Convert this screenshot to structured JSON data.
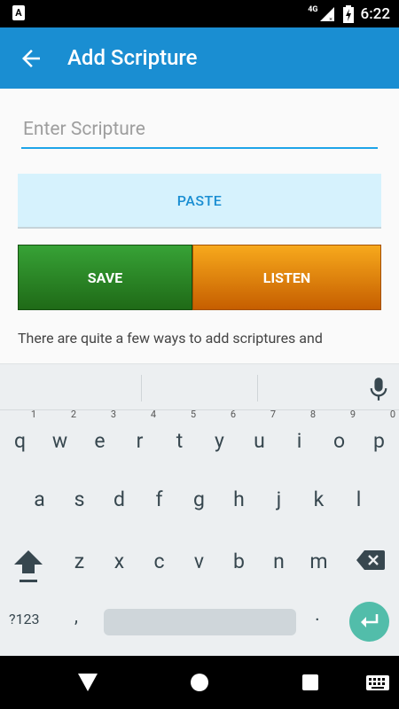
{
  "status_bar": {
    "app_icon_letter": "A",
    "network": "4G",
    "time": "6:22"
  },
  "app_bar": {
    "title": "Add Scripture",
    "back_icon": "arrow-back-icon"
  },
  "form": {
    "scripture_input": {
      "value": "",
      "placeholder": "Enter Scripture"
    },
    "paste_label": "PASTE",
    "save_label": "SAVE",
    "listen_label": "LISTEN",
    "help_text": "There are quite a few ways to add scriptures and"
  },
  "keyboard": {
    "row1": [
      "q",
      "w",
      "e",
      "r",
      "t",
      "y",
      "u",
      "i",
      "o",
      "p"
    ],
    "row1_hints": [
      "1",
      "2",
      "3",
      "4",
      "5",
      "6",
      "7",
      "8",
      "9",
      "0"
    ],
    "row2": [
      "a",
      "s",
      "d",
      "f",
      "g",
      "h",
      "j",
      "k",
      "l"
    ],
    "row3": [
      "z",
      "x",
      "c",
      "v",
      "b",
      "n",
      "m"
    ],
    "symbols_label": "?123",
    "comma": ",",
    "period": "."
  },
  "colors": {
    "app_bar": "#1a8ed2",
    "save_button": "#2a8a26",
    "listen_button": "#e08a0f",
    "paste_bg": "#d6f2fd",
    "enter_key": "#52bdaa"
  }
}
